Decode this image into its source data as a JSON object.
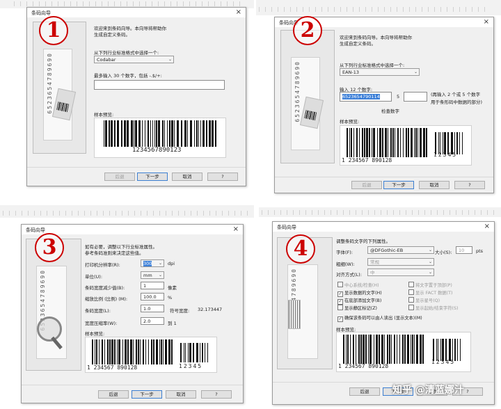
{
  "dialog_title": "条码向导",
  "close_glyph": "×",
  "buttons": {
    "back": "后退",
    "next": "下一步",
    "cancel": "取消",
    "help": "?"
  },
  "step_badges": [
    "1",
    "2",
    "3",
    "4"
  ],
  "sample_label_digits": "6523654789690",
  "step1": {
    "intro": [
      "欢迎来到条码向导。本向导将帮助你",
      "生成自定义条码。"
    ],
    "industry_label": "从下列行业标准格式中选择一个:",
    "format_value": "Codabar",
    "input_label": "最多输入 30 个数字，包括 -.$/+:",
    "input_value": "",
    "preview_label": "样本预览:",
    "barcode_text": "1234567890123"
  },
  "step2": {
    "intro": [
      "欢迎来到条码向导。本向导将帮助你",
      "生成自定义条码。"
    ],
    "industry_label": "从下列行业标准格式中选择一个:",
    "format_value": "EAN-13",
    "input_label": "输入 12 个数字:",
    "input_value": "6523654790114",
    "check_digit": "5",
    "hint": [
      "(再输入 2 个或 5 个数字",
      "用于条形码中数据的部分)"
    ],
    "check_label": "检查数字",
    "preview_label": "样本预览:",
    "barcode_left": "1 234567 890128",
    "barcode_addon": "12345"
  },
  "step3": {
    "intro": [
      "如有必要，调整以下行业标准属性。",
      "参考条码准则来决定这些值。"
    ],
    "fields": [
      {
        "label": "打印机分辨率(R):",
        "value": "300",
        "unit": "dpi",
        "kind": "select"
      },
      {
        "label": "单位(U):",
        "value": "mm",
        "unit": "",
        "kind": "select"
      },
      {
        "label": "条码宽度减少值(B):",
        "value": "1",
        "unit": "像素",
        "kind": "spin"
      },
      {
        "label": "缩放比例 (比例) (M):",
        "value": "100.0",
        "unit": "%",
        "kind": "spin"
      },
      {
        "label": "条码宽度(L):",
        "value": "1.0",
        "unit": "",
        "kind": "spin"
      },
      {
        "label": "宽度压缩率(W):",
        "value": "2.0",
        "unit": "到 1",
        "kind": "spin"
      }
    ],
    "symbol_width_label": "符号宽度:",
    "symbol_width_value": "32.173447",
    "preview_label": "样本预览:",
    "barcode_left": "1 234567 890128",
    "barcode_addon": "12345"
  },
  "step4": {
    "intro": "调整条码文字的下列属性。",
    "font_label": "字体(F):",
    "font_value": "@DFGothic-EB",
    "size_label": "大小(S):",
    "size_value": "10",
    "size_unit": "pts",
    "style_label": "粗细(W):",
    "style_value": "常规",
    "align_label": "对齐方式(L):",
    "align_value": "中",
    "left_checks": [
      {
        "label": "中心系统/检查(H)",
        "checked": false,
        "disabled": true
      },
      {
        "label": "显示数据的文字(H)",
        "checked": true,
        "disabled": false
      },
      {
        "label": "在底部添加文字(B)",
        "checked": true,
        "disabled": false
      },
      {
        "label": "显示静区标记(Z)",
        "checked": false,
        "disabled": false
      }
    ],
    "right_checks": [
      {
        "label": "将文字置于顶部(P)",
        "checked": false,
        "disabled": true
      },
      {
        "label": "显示 FACT 数据(T)",
        "checked": false,
        "disabled": true
      },
      {
        "label": "显示星号(Q)",
        "checked": false,
        "disabled": true
      },
      {
        "label": "显示起始/结束字符(S)",
        "checked": false,
        "disabled": true
      }
    ],
    "readable_check": "确保该条码可以由人读出 (显示文本)(M)",
    "preview_label": "样本预览:",
    "barcode_left": "1 234567 890128",
    "barcode_addon": "12345"
  },
  "watermark": "知乎 @清蓝娜汁"
}
